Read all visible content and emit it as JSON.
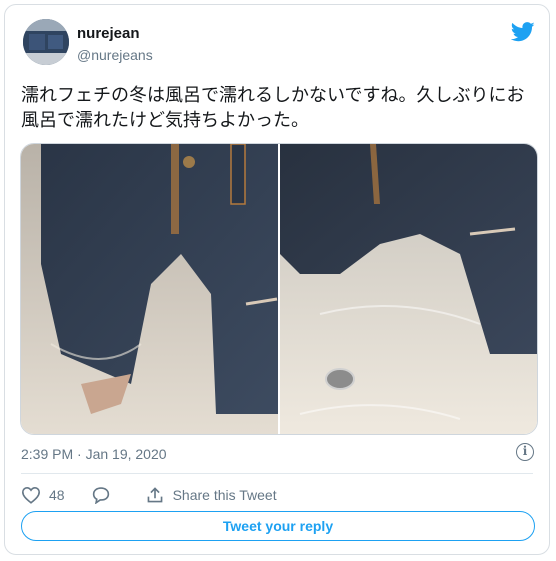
{
  "user": {
    "name": "nurejean",
    "handle": "@nurejeans"
  },
  "tweet": {
    "text": "濡れフェチの冬は風呂で濡れるしかないですね。久しぶりにお風呂で濡れたけど気持ちよかった。",
    "media": [
      "photo-jeans-bath-left",
      "photo-jeans-bath-right"
    ]
  },
  "meta": {
    "timestamp": "2:39 PM · Jan 19, 2020",
    "info_glyph": "i"
  },
  "actions": {
    "like_count": "48",
    "share_label": "Share this Tweet"
  },
  "reply": {
    "label": "Tweet your reply"
  },
  "colors": {
    "brand": "#1da1f2",
    "muted": "#657786",
    "text": "#14171a",
    "border": "#e1e8ed"
  },
  "icons": [
    "avatar",
    "twitter-bird-icon",
    "info-icon",
    "heart-icon",
    "reply-icon",
    "share-icon"
  ]
}
